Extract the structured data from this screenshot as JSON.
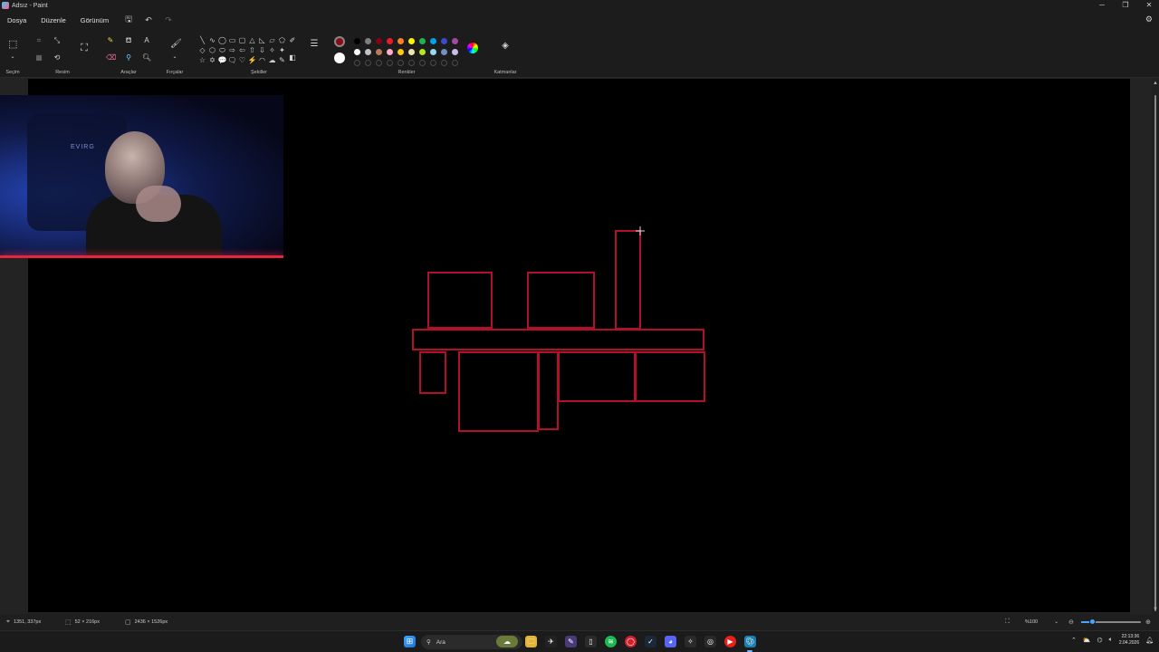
{
  "window": {
    "title": "Adsız - Paint"
  },
  "menu": {
    "items": [
      "Dosya",
      "Düzenle",
      "Görünüm"
    ]
  },
  "ribbon": {
    "groups": {
      "selection": "Seçim",
      "image": "Resim",
      "tools": "Araçlar",
      "brushes": "Fırçalar",
      "shapes": "Şekiller",
      "colors": "Renkler",
      "layers": "Katmanlar"
    },
    "current_colors": {
      "primary": "#8b0a14",
      "secondary": "#ffffff"
    },
    "palette_row1": [
      "#000000",
      "#7f7f7f",
      "#880015",
      "#ed1c24",
      "#ff7f27",
      "#fff200",
      "#22b14c",
      "#00a2e8",
      "#3f48cc",
      "#a349a4"
    ],
    "palette_row2": [
      "#ffffff",
      "#c3c3c3",
      "#b97a57",
      "#ffaec9",
      "#ffc90e",
      "#efe4b0",
      "#b5e61d",
      "#99d9ea",
      "#7092be",
      "#c8bfe7"
    ],
    "shape_glyphs": [
      "╲",
      "∿",
      "◯",
      "▭",
      "▢",
      "△",
      "◺",
      "▱",
      "⬠",
      "◇",
      "⬡",
      "⬭",
      "⇨",
      "⇦",
      "⇧",
      "⇩",
      "✧",
      "✦",
      "☆",
      "✡",
      "💬",
      "🗨",
      "♡",
      "⚡",
      "◠",
      "☁",
      "✎"
    ]
  },
  "canvas": {
    "background": "#000000",
    "stroke_color": "#b0102a",
    "drawing": "Kırmızı dikdörtgenler"
  },
  "webcam": {
    "sign_text": "EVIRG"
  },
  "status": {
    "cursor_position": "1351, 337px",
    "selection_size": "52 × 216px",
    "canvas_size": "2436 × 1526px",
    "zoom": "%100"
  },
  "taskbar": {
    "search_placeholder": "Ara",
    "time": "22:13:36",
    "date": "2.04.2026"
  }
}
